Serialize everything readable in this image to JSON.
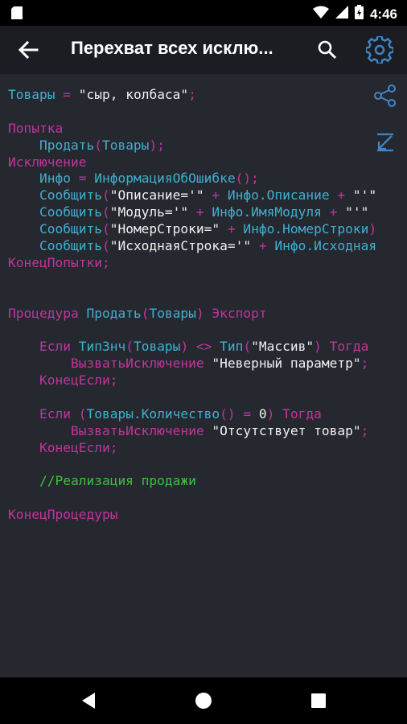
{
  "status_bar": {
    "time": "4:46"
  },
  "app_bar": {
    "title": "Перехват всех исклю..."
  },
  "colors": {
    "keyword": "#c0359a",
    "identifier": "#3fb0cf",
    "comment": "#3fbf3f",
    "accent": "#3f86c9",
    "background": "#262830"
  },
  "code_lines": [
    [
      [
        "id",
        "Товары"
      ],
      [
        "op",
        " = "
      ],
      [
        "str",
        "\"сыр, колбаса\""
      ],
      [
        "op",
        ";"
      ]
    ],
    [],
    [
      [
        "kw",
        "Попытка"
      ]
    ],
    [
      [
        "id",
        "    Продать"
      ],
      [
        "op",
        "("
      ],
      [
        "id",
        "Товары"
      ],
      [
        "op",
        ");"
      ]
    ],
    [
      [
        "kw",
        "Исключение"
      ]
    ],
    [
      [
        "id",
        "    Инфо"
      ],
      [
        "op",
        " = "
      ],
      [
        "id",
        "ИнформацияОбОшибке"
      ],
      [
        "op",
        "();"
      ]
    ],
    [
      [
        "id",
        "    Сообщить"
      ],
      [
        "op",
        "("
      ],
      [
        "str",
        "\"Описание='\""
      ],
      [
        "op",
        " + "
      ],
      [
        "id",
        "Инфо.Описание"
      ],
      [
        "op",
        " + "
      ],
      [
        "str",
        "\"'\""
      ]
    ],
    [
      [
        "id",
        "    Сообщить"
      ],
      [
        "op",
        "("
      ],
      [
        "str",
        "\"Модуль='\""
      ],
      [
        "op",
        " + "
      ],
      [
        "id",
        "Инфо.ИмяМодуля"
      ],
      [
        "op",
        " + "
      ],
      [
        "str",
        "\"'\""
      ]
    ],
    [
      [
        "id",
        "    Сообщить"
      ],
      [
        "op",
        "("
      ],
      [
        "str",
        "\"НомерСтроки=\""
      ],
      [
        "op",
        " + "
      ],
      [
        "id",
        "Инфо.НомерСтроки"
      ],
      [
        "op",
        ")"
      ]
    ],
    [
      [
        "id",
        "    Сообщить"
      ],
      [
        "op",
        "("
      ],
      [
        "str",
        "\"ИсходнаяСтрока='\""
      ],
      [
        "op",
        " + "
      ],
      [
        "id",
        "Инфо.Исходная"
      ]
    ],
    [
      [
        "kw",
        "КонецПопытки"
      ],
      [
        "op",
        ";"
      ]
    ],
    [],
    [],
    [
      [
        "kw",
        "Процедура "
      ],
      [
        "id",
        "Продать"
      ],
      [
        "op",
        "("
      ],
      [
        "id",
        "Товары"
      ],
      [
        "op",
        ") "
      ],
      [
        "kw",
        "Экспорт"
      ]
    ],
    [],
    [
      [
        "kw",
        "    Если "
      ],
      [
        "id",
        "ТипЗнч"
      ],
      [
        "op",
        "("
      ],
      [
        "id",
        "Товары"
      ],
      [
        "op",
        ") <> "
      ],
      [
        "id",
        "Тип"
      ],
      [
        "op",
        "("
      ],
      [
        "str",
        "\"Массив\""
      ],
      [
        "op",
        ") "
      ],
      [
        "kw",
        "Тогда"
      ]
    ],
    [
      [
        "kw",
        "        ВызватьИсключение "
      ],
      [
        "str",
        "\"Неверный параметр\""
      ],
      [
        "op",
        ";"
      ]
    ],
    [
      [
        "kw",
        "    КонецЕсли"
      ],
      [
        "op",
        ";"
      ]
    ],
    [],
    [
      [
        "kw",
        "    Если "
      ],
      [
        "op",
        "("
      ],
      [
        "id",
        "Товары.Количество"
      ],
      [
        "op",
        "() = "
      ],
      [
        "num",
        "0"
      ],
      [
        "op",
        ") "
      ],
      [
        "kw",
        "Тогда"
      ]
    ],
    [
      [
        "kw",
        "        ВызватьИсключение "
      ],
      [
        "str",
        "\"Отсутствует товар\""
      ],
      [
        "op",
        ";"
      ]
    ],
    [
      [
        "kw",
        "    КонецЕсли"
      ],
      [
        "op",
        ";"
      ]
    ],
    [],
    [
      [
        "cmt",
        "    //Реализация продажи"
      ]
    ],
    [],
    [
      [
        "kw",
        "КонецПроцедуры"
      ]
    ]
  ]
}
